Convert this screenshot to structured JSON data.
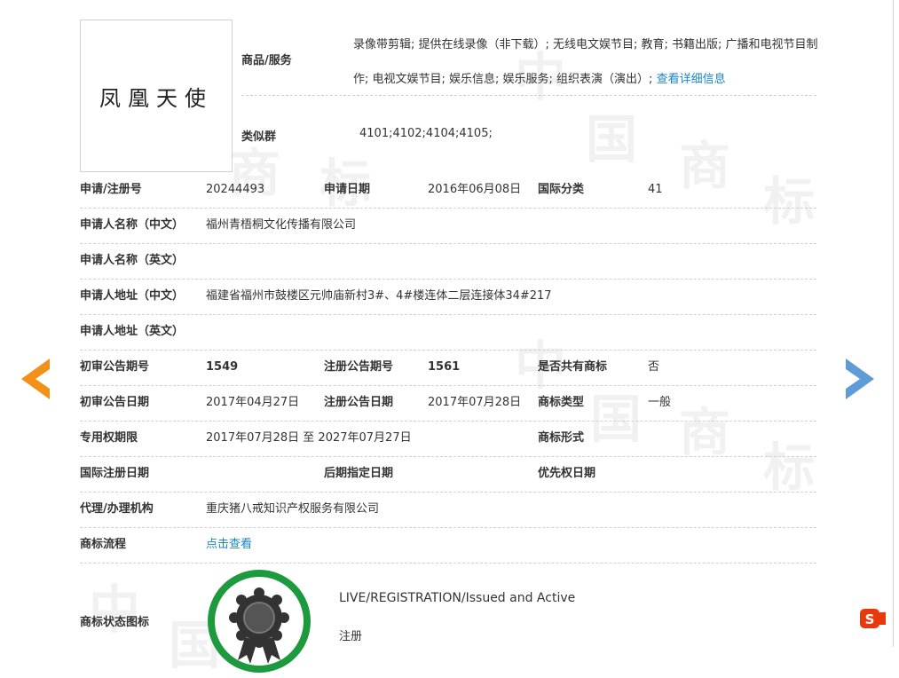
{
  "trademark": {
    "logo_text": "凤凰天使",
    "goods_services_label": "商品/服务",
    "goods_services_text": "录像带剪辑; 提供在线录像（非下载）; 无线电文娱节目; 教育; 书籍出版; 广播和电视节目制作; 电视文娱节目; 娱乐信息; 娱乐服务; 组织表演（演出）;",
    "detail_link": "查看详细信息",
    "similar_group_label": "类似群",
    "similar_group_value": "4101;4102;4104;4105;"
  },
  "rows": {
    "reg_no_label": "申请/注册号",
    "reg_no_value": "20244493",
    "app_date_label": "申请日期",
    "app_date_value": "2016年06月08日",
    "intl_class_label": "国际分类",
    "intl_class_value": "41",
    "applicant_cn_label": "申请人名称（中文）",
    "applicant_cn_value": "福州青梧桐文化传播有限公司",
    "applicant_en_label": "申请人名称（英文）",
    "address_cn_label": "申请人地址（中文）",
    "address_cn_value": "福建省福州市鼓楼区元帅庙新村3#、4#楼连体二层连接体34#217",
    "address_en_label": "申请人地址（英文）",
    "prelim_no_label": "初审公告期号",
    "prelim_no_value": "1549",
    "reg_pub_no_label": "注册公告期号",
    "reg_pub_no_value": "1561",
    "shared_label": "是否共有商标",
    "shared_value": "否",
    "prelim_date_label": "初审公告日期",
    "prelim_date_value": "2017年04月27日",
    "reg_pub_date_label": "注册公告日期",
    "reg_pub_date_value": "2017年07月28日",
    "tm_type_label": "商标类型",
    "tm_type_value": "一般",
    "exclusive_label": "专用权期限",
    "exclusive_value": "2017年07月28日 至 2027年07月27日",
    "tm_form_label": "商标形式",
    "intl_reg_date_label": "国际注册日期",
    "later_date_label": "后期指定日期",
    "priority_date_label": "优先权日期",
    "agent_label": "代理/办理机构",
    "agent_value": "重庆猪八戒知识产权服务有限公司",
    "process_label": "商标流程",
    "process_link": "点击查看"
  },
  "status": {
    "label": "商标状态图标",
    "en": "LIVE/REGISTRATION/Issued and Active",
    "cn": "注册"
  },
  "watermark": {
    "c1": "中",
    "c2": "国",
    "c3": "商",
    "c4": "标"
  },
  "colors": {
    "link": "#1a87c9",
    "prev_arrow": "#f39019",
    "next_arrow": "#5f9bd6",
    "seal_ring": "#1e9a3e"
  },
  "icons": {
    "prev": "arrow-left-icon",
    "next": "arrow-right-icon",
    "seal": "ribbon-seal-icon",
    "ime": "sogou-ime-icon"
  }
}
